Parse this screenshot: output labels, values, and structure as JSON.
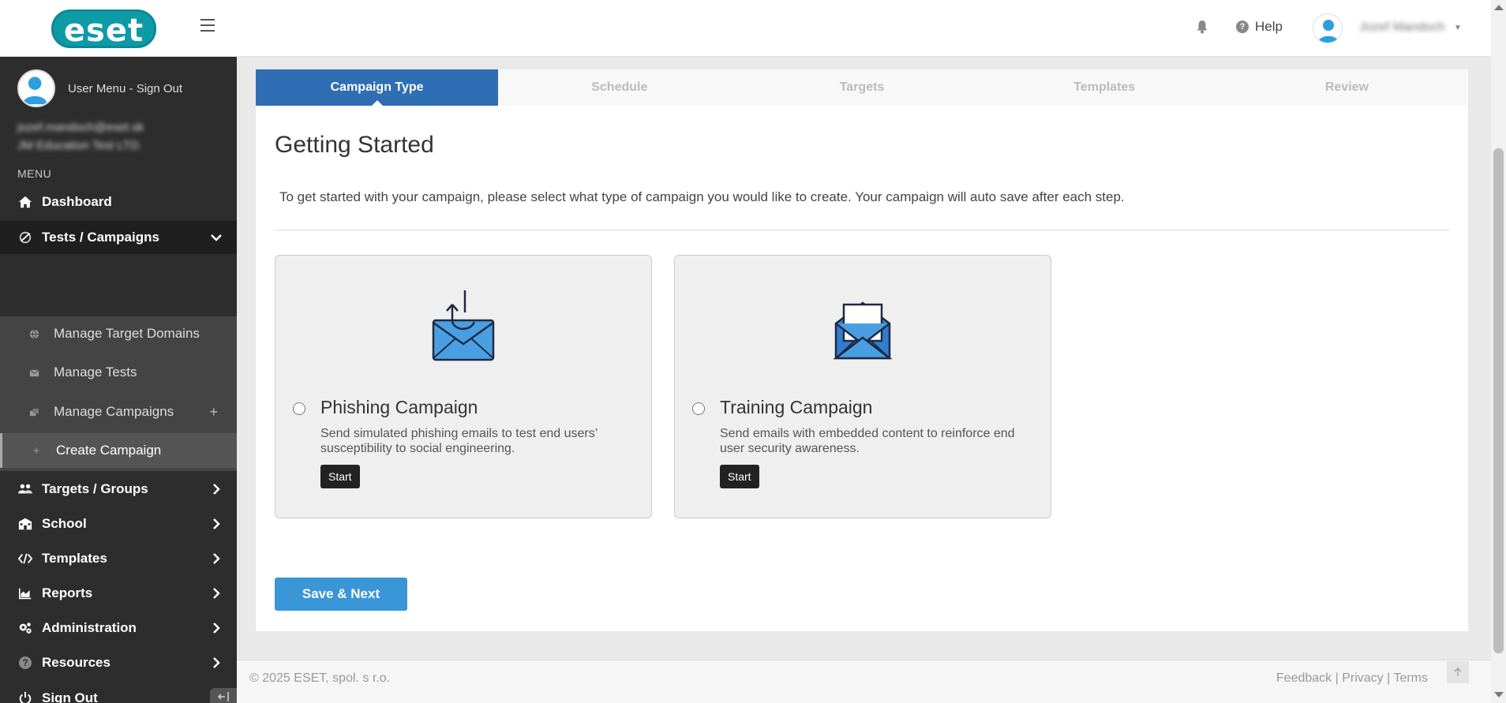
{
  "header": {
    "logo_text": "eset",
    "help_label": "Help",
    "username": "Jozef Mandoch"
  },
  "sidebar": {
    "user_menu_link": "User Menu",
    "separator": " - ",
    "sign_out_link": "Sign Out",
    "email": "jozef.mandoch@eset.sk",
    "company": "JM Education Test LTD.",
    "menu_label": "MENU",
    "items": [
      {
        "label": "Dashboard",
        "icon": "home-icon"
      },
      {
        "label": "Tests / Campaigns",
        "icon": "campaign-icon"
      },
      {
        "label": "Targets / Groups",
        "icon": "users-icon"
      },
      {
        "label": "School",
        "icon": "school-icon"
      },
      {
        "label": "Templates",
        "icon": "code-icon"
      },
      {
        "label": "Reports",
        "icon": "chart-icon"
      },
      {
        "label": "Administration",
        "icon": "gears-icon"
      },
      {
        "label": "Resources",
        "icon": "question-icon"
      },
      {
        "label": "Sign Out",
        "icon": "power-icon"
      }
    ],
    "sub_items": [
      {
        "label": "Manage Target Domains",
        "icon": "globe-icon"
      },
      {
        "label": "Manage Tests",
        "icon": "envelope-icon"
      },
      {
        "label": "Manage Campaigns",
        "icon": "campaigns-icon",
        "action": "+"
      },
      {
        "label": "Create Campaign",
        "icon": "plus-icon"
      }
    ]
  },
  "wizard": {
    "steps": [
      "Campaign Type",
      "Schedule",
      "Targets",
      "Templates",
      "Review"
    ],
    "active_step": "Campaign Type"
  },
  "main": {
    "title": "Getting Started",
    "intro": "To get started with your campaign, please select what type of campaign you would like to create. Your campaign will auto save after each step.",
    "cards": [
      {
        "title": "Phishing Campaign",
        "description": "Send simulated phishing emails to test end users’ susceptibility to social engineering.",
        "button": "Start",
        "icon": "phishing-envelope-icon"
      },
      {
        "title": "Training Campaign",
        "description": "Send emails with embedded content to reinforce end user security awareness.",
        "button": "Start",
        "icon": "open-envelope-icon"
      }
    ],
    "save_button": "Save & Next"
  },
  "footer": {
    "copyright": "© 2025 ESET, spol. s r.o.",
    "links": [
      "Feedback",
      "Privacy",
      "Terms"
    ],
    "link_separator": " | "
  },
  "colors": {
    "accent": "#2f6db4",
    "button_blue": "#3996d7",
    "brand_teal": "#0e9aa7",
    "sidebar_bg": "#2d2d2d"
  }
}
